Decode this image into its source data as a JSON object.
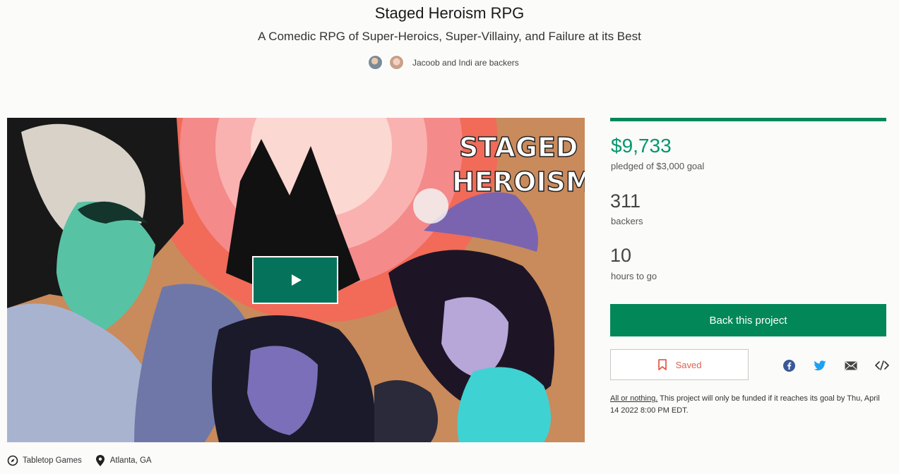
{
  "project": {
    "title": "Staged Heroism RPG",
    "subtitle": "A Comedic RPG of Super-Heroics, Super-Villainy, and Failure at its Best",
    "backers_note": "Jacoob and Indi are backers",
    "art_title_line1": "STAGED",
    "art_title_line2": "HEROISM"
  },
  "stats": {
    "pledged": "$9,733",
    "pledged_label": "pledged of $3,000 goal",
    "progress_fraction": 1.0,
    "backers": "311",
    "backers_label": "backers",
    "time_left": "10",
    "time_left_label": "hours to go"
  },
  "actions": {
    "back_label": "Back this project",
    "saved_label": "Saved"
  },
  "share_icons": [
    "facebook-icon",
    "twitter-icon",
    "email-icon",
    "embed-icon"
  ],
  "funding": {
    "link_text": "All or nothing.",
    "text": " This project will only be funded if it reaches its goal by Thu, April 14 2022 8:00 PM EDT."
  },
  "meta": {
    "category": "Tabletop Games",
    "location": "Atlanta, GA"
  },
  "colors": {
    "accent_green": "#028858",
    "pledged_green": "#05966e",
    "saved_red": "#e06050"
  }
}
